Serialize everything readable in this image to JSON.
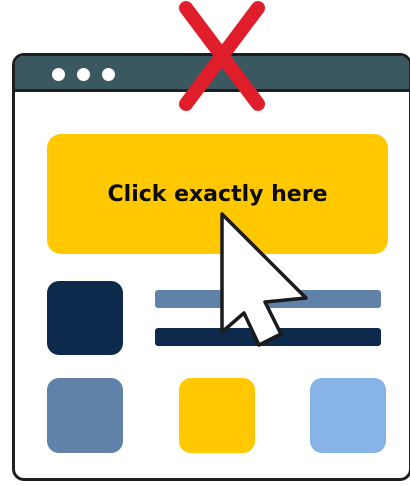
{
  "window": {
    "title_dots": [
      "dot",
      "dot",
      "dot"
    ]
  },
  "main": {
    "cta_label": "Click exactly here"
  },
  "icons": {
    "pointer": "mouse-pointer-icon",
    "cross": "red-x-icon"
  },
  "colors": {
    "titlebar": "#3b5760",
    "cta": "#ffc800",
    "navy": "#0d2a4d",
    "steel": "#6182a8",
    "sky": "#87b3e6",
    "cross": "#e01e2b"
  }
}
